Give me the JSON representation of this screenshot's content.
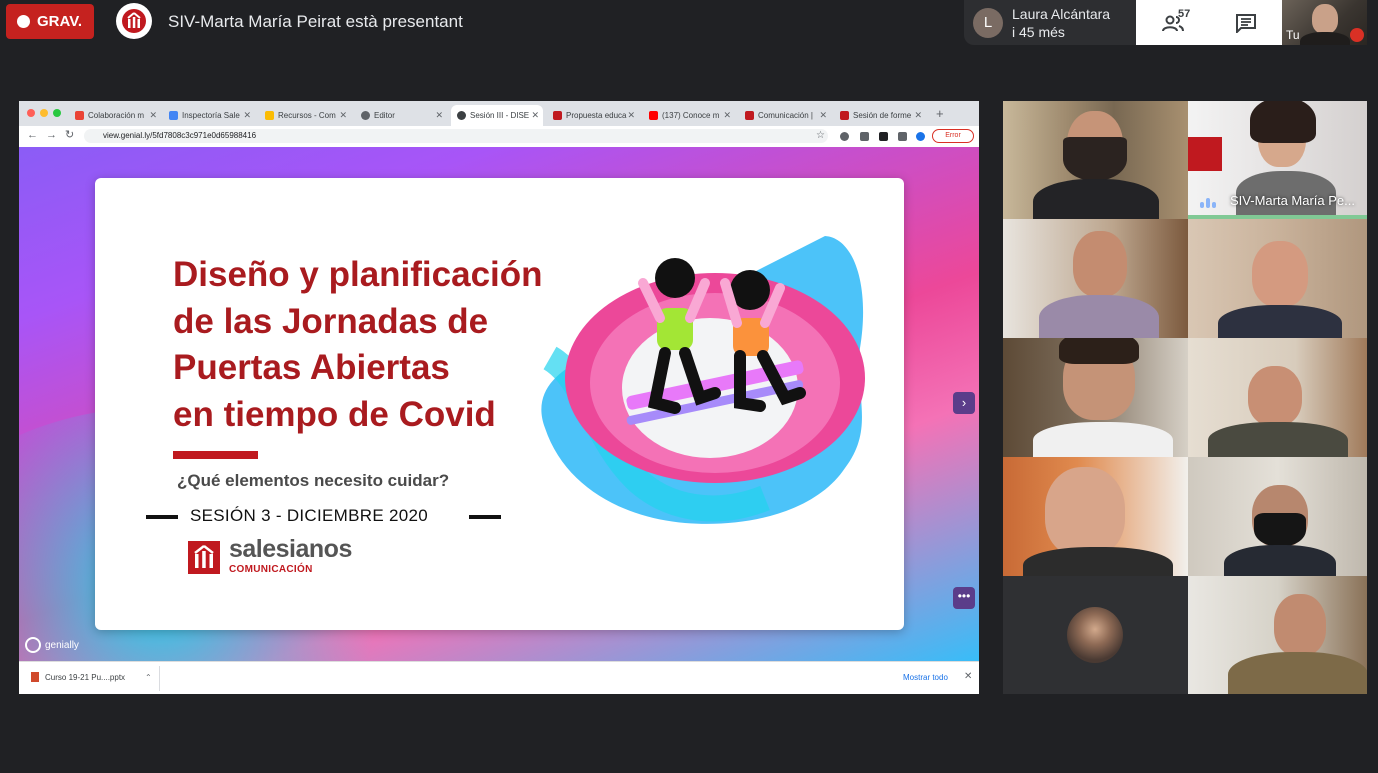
{
  "recording": {
    "label": "GRAV."
  },
  "presenter": {
    "text": "SIV-Marta María Peirat està presentant"
  },
  "notification": {
    "avatar_initial": "L",
    "line1": "Laura Alcántara",
    "line2": "i 45 més"
  },
  "controls": {
    "people_count": "57",
    "people_icon": "people-icon",
    "chat_icon": "chat-icon"
  },
  "self_view": {
    "label": "Tu"
  },
  "browser": {
    "tabs": [
      {
        "label": "Colaboración m",
        "icon": "gmail-icon",
        "color": "#ea4335"
      },
      {
        "label": "Inspectoría Sale",
        "icon": "page-icon",
        "color": "#4285f4"
      },
      {
        "label": "Recursos - Com",
        "icon": "drive-icon",
        "color": "#fbbc04"
      },
      {
        "label": "Editor",
        "icon": "editor-icon",
        "color": "#5f6368"
      },
      {
        "label": "Sesión III - DISE",
        "icon": "genially-tab-icon",
        "color": "#3c4043"
      },
      {
        "label": "Propuesta educa",
        "icon": "salesianos-tab-icon",
        "color": "#c0191f"
      },
      {
        "label": "(137) Conoce m",
        "icon": "youtube-icon",
        "color": "#ff0000"
      },
      {
        "label": "Comunicación |",
        "icon": "salesianos-tab-icon",
        "color": "#c0191f"
      },
      {
        "label": "Sesión de forme",
        "icon": "salesianos-tab-icon",
        "color": "#c0191f"
      }
    ],
    "url": "view.genial.ly/5fd7808c3c971e0d65988416",
    "error_label": "Error"
  },
  "slide": {
    "title_lines": [
      "Diseño y planificación",
      "de las Jornadas de",
      "Puertas Abiertas",
      "en tiempo de Covid"
    ],
    "question": "¿Qué elementos necesito cuidar?",
    "session": "SESIÓN 3 - DICIEMBRE 2020",
    "brand_name": "salesianos",
    "brand_sub": "COMUNICACIÓN"
  },
  "genially": {
    "label": "genially"
  },
  "download": {
    "file": "Curso 19-21 Pu....pptx",
    "show_all": "Mostrar todo"
  },
  "participants": [
    {
      "name": ""
    },
    {
      "name": "SIV-Marta María Pe..."
    },
    {
      "name": ""
    },
    {
      "name": ""
    },
    {
      "name": ""
    },
    {
      "name": ""
    },
    {
      "name": ""
    },
    {
      "name": ""
    },
    {
      "name": ""
    },
    {
      "name": ""
    }
  ],
  "colors": {
    "accent_red": "#c5221f",
    "slide_red": "#a91b1f",
    "speaking_green": "#81c995"
  }
}
